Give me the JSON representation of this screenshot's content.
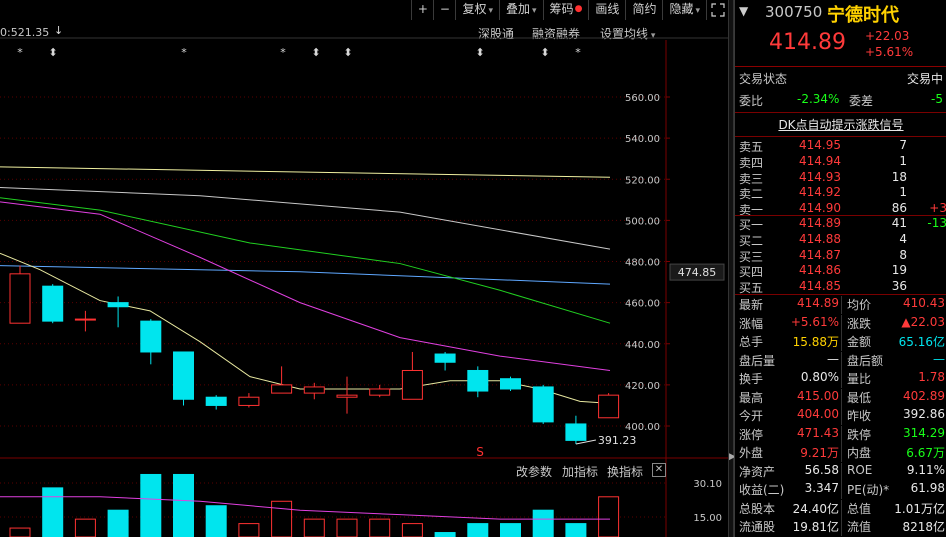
{
  "toolbar": {
    "plus": "+",
    "minus": "−",
    "fq": "复权",
    "add": "叠加",
    "chip": "筹码",
    "draw": "画线",
    "simple": "简约",
    "hide": "隐藏",
    "arrow": "▾",
    "expand_icon": "expand-icon"
  },
  "chart": {
    "high_label": "0:521.35",
    "high_arrow": "↓",
    "opts": {
      "sgt": "深股通",
      "rzrq": "融资融券",
      "avg": "设置均线"
    },
    "markers": [
      "*",
      "⬍",
      "*",
      "*",
      "⬍",
      "⬍",
      "⬍",
      "⬍",
      "*"
    ],
    "low_label": "391.23",
    "s_marker": "S",
    "current_price_tag": "474.85",
    "vol_buttons": {
      "params": "改参数",
      "add": "加指标",
      "swap": "换指标",
      "close": "✕"
    },
    "vol_ticks": [
      "30.10",
      "15.00"
    ]
  },
  "chart_data": {
    "type": "candlestick",
    "y_ticks": [
      "560.00",
      "540.00",
      "520.00",
      "500.00",
      "480.00",
      "460.00",
      "440.00",
      "420.00",
      "400.00"
    ],
    "ylim": [
      393,
      571
    ],
    "candles": [
      {
        "o": 450,
        "c": 474,
        "h": 478,
        "l": 450
      },
      {
        "o": 468,
        "c": 451,
        "h": 469,
        "l": 450
      },
      {
        "o": 452,
        "c": 452,
        "h": 456,
        "l": 446
      },
      {
        "o": 460,
        "c": 458,
        "h": 463,
        "l": 448
      },
      {
        "o": 451,
        "c": 436,
        "h": 452,
        "l": 430
      },
      {
        "o": 436,
        "c": 413,
        "h": 436,
        "l": 410
      },
      {
        "o": 414,
        "c": 410,
        "h": 415,
        "l": 408
      },
      {
        "o": 410,
        "c": 414,
        "h": 416,
        "l": 409
      },
      {
        "o": 416,
        "c": 420,
        "h": 429,
        "l": 416
      },
      {
        "o": 416,
        "c": 419,
        "h": 421,
        "l": 413
      },
      {
        "o": 414,
        "c": 415,
        "h": 424,
        "l": 406
      },
      {
        "o": 415,
        "c": 418,
        "h": 420,
        "l": 414
      },
      {
        "o": 413,
        "c": 427,
        "h": 436,
        "l": 413
      },
      {
        "o": 435,
        "c": 431,
        "h": 436,
        "l": 427
      },
      {
        "o": 427,
        "c": 417,
        "h": 429,
        "l": 414
      },
      {
        "o": 423,
        "c": 418,
        "h": 424,
        "l": 417
      },
      {
        "o": 419,
        "c": 402,
        "h": 420,
        "l": 401
      },
      {
        "o": 401,
        "c": 393,
        "h": 405,
        "l": 391.23
      },
      {
        "o": 404,
        "c": 415,
        "h": 416,
        "l": 404
      }
    ],
    "ma_lines": [
      {
        "color": "#f0f0a0",
        "pts": [
          [
            0,
            526
          ],
          [
            610,
            521
          ]
        ]
      },
      {
        "color": "#c8c8c8",
        "pts": [
          [
            0,
            516
          ],
          [
            200,
            512
          ],
          [
            400,
            504
          ],
          [
            610,
            486
          ]
        ]
      },
      {
        "color": "#5fa8ff",
        "pts": [
          [
            0,
            478
          ],
          [
            300,
            475
          ],
          [
            610,
            469
          ]
        ]
      },
      {
        "color": "#21d021",
        "pts": [
          [
            0,
            511
          ],
          [
            100,
            505
          ],
          [
            250,
            489
          ],
          [
            400,
            479
          ],
          [
            500,
            466
          ],
          [
            610,
            450
          ]
        ]
      },
      {
        "color": "#e040e0",
        "pts": [
          [
            0,
            509
          ],
          [
            100,
            503
          ],
          [
            200,
            482
          ],
          [
            300,
            460
          ],
          [
            400,
            443
          ],
          [
            500,
            434
          ],
          [
            610,
            427
          ]
        ]
      },
      {
        "color": "#e8e8a0",
        "pts": [
          [
            0,
            484
          ],
          [
            40,
            476
          ],
          [
            100,
            461
          ],
          [
            150,
            456
          ],
          [
            200,
            441
          ],
          [
            250,
            424
          ],
          [
            300,
            418
          ],
          [
            350,
            418
          ],
          [
            400,
            418
          ],
          [
            450,
            422
          ],
          [
            500,
            422
          ],
          [
            540,
            418
          ],
          [
            580,
            412
          ],
          [
            610,
            411
          ]
        ]
      }
    ],
    "volumes": [
      2,
      11,
      4,
      6,
      14,
      14,
      7,
      3,
      8,
      4,
      4,
      4,
      3,
      1,
      3,
      3,
      6,
      3,
      9
    ],
    "vol_ma": [
      [
        0,
        9
      ],
      [
        100,
        9
      ],
      [
        200,
        8
      ],
      [
        300,
        6
      ],
      [
        400,
        5
      ],
      [
        500,
        4
      ],
      [
        610,
        4
      ]
    ]
  },
  "quote": {
    "code": "300750",
    "name": "宁德时代",
    "price": "414.89",
    "change": "+22.03",
    "change_pct": "+5.61%",
    "trade_status_label": "交易状态",
    "trade_status": "交易中",
    "wb_label": "委比",
    "wb": "-2.34%",
    "wc_label": "委差",
    "wc": "-5",
    "dk_signal": "DK点自动提示涨跌信号",
    "asks": [
      {
        "label": "卖五",
        "price": "414.95",
        "vol": "7",
        "delta": ""
      },
      {
        "label": "卖四",
        "price": "414.94",
        "vol": "1",
        "delta": ""
      },
      {
        "label": "卖三",
        "price": "414.93",
        "vol": "18",
        "delta": ""
      },
      {
        "label": "卖二",
        "price": "414.92",
        "vol": "1",
        "delta": ""
      },
      {
        "label": "卖一",
        "price": "414.90",
        "vol": "86",
        "delta": "+3"
      }
    ],
    "bids": [
      {
        "label": "买一",
        "price": "414.89",
        "vol": "41",
        "delta": "-13"
      },
      {
        "label": "买二",
        "price": "414.88",
        "vol": "4",
        "delta": ""
      },
      {
        "label": "买三",
        "price": "414.87",
        "vol": "8",
        "delta": ""
      },
      {
        "label": "买四",
        "price": "414.86",
        "vol": "19",
        "delta": ""
      },
      {
        "label": "买五",
        "price": "414.85",
        "vol": "36",
        "delta": ""
      }
    ],
    "stats": [
      {
        "l1": "最新",
        "v1": "414.89",
        "c1": "red",
        "l2": "均价",
        "v2": "410.43",
        "c2": "red"
      },
      {
        "l1": "涨幅",
        "v1": "+5.61%",
        "c1": "red",
        "l2": "涨跌",
        "v2": "▲22.03",
        "c2": "red"
      },
      {
        "l1": "总手",
        "v1": "15.88万",
        "c1": "yellow",
        "l2": "金额",
        "v2": "65.16亿",
        "c2": "cyan"
      },
      {
        "l1": "盘后量",
        "v1": "—",
        "c1": "white",
        "l2": "盘后额",
        "v2": "—",
        "c2": "cyan"
      },
      {
        "l1": "换手",
        "v1": "0.80%",
        "c1": "white",
        "l2": "量比",
        "v2": "1.78",
        "c2": "red"
      },
      {
        "l1": "最高",
        "v1": "415.00",
        "c1": "red",
        "l2": "最低",
        "v2": "402.89",
        "c2": "red"
      },
      {
        "l1": "今开",
        "v1": "404.00",
        "c1": "red",
        "l2": "昨收",
        "v2": "392.86",
        "c2": "white"
      },
      {
        "l1": "涨停",
        "v1": "471.43",
        "c1": "red",
        "l2": "跌停",
        "v2": "314.29",
        "c2": "green"
      },
      {
        "l1": "外盘",
        "v1": "9.21万",
        "c1": "red",
        "l2": "内盘",
        "v2": "6.67万",
        "c2": "green"
      },
      {
        "l1": "净资产",
        "v1": "56.58",
        "c1": "white",
        "l2": "ROE",
        "v2": "9.11%",
        "c2": "white"
      },
      {
        "l1": "收益(二)",
        "v1": "3.347",
        "c1": "white",
        "l2": "PE(动)*",
        "v2": "61.98",
        "c2": "white"
      },
      {
        "l1": "总股本",
        "v1": "24.40亿",
        "c1": "white",
        "l2": "总值",
        "v2": "1.01万亿",
        "c2": "white"
      },
      {
        "l1": "流通股",
        "v1": "19.81亿",
        "c1": "white",
        "l2": "流值",
        "v2": "8218亿",
        "c2": "white"
      }
    ]
  }
}
